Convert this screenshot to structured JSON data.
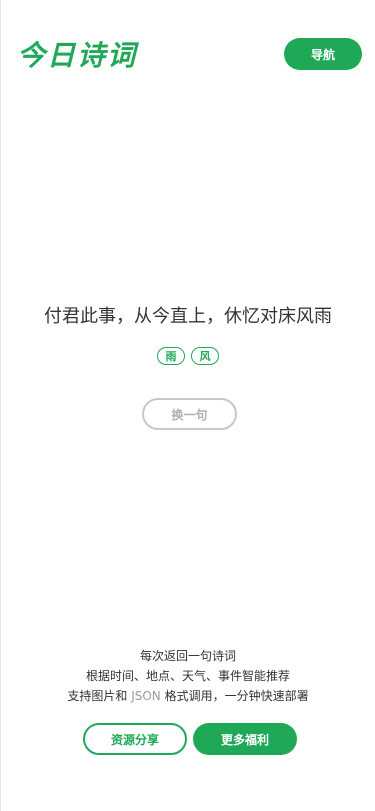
{
  "header": {
    "logo_text": "今日诗词",
    "nav_label": "导航"
  },
  "poem": {
    "text": "付君此事，从今直上，休忆对床风雨",
    "tags": [
      "雨",
      "风"
    ],
    "refresh_label": "换一句"
  },
  "description": {
    "line1": "每次返回一句诗词",
    "line2": "根据时间、地点、天气、事件智能推荐",
    "line3_prefix": "支持图片和 ",
    "line3_json": "JSON",
    "line3_suffix": " 格式调用，一分钟快速部署"
  },
  "footer": {
    "resources_label": "资源分享",
    "more_label": "更多福利"
  },
  "colors": {
    "brand_green": "#1fa957",
    "disabled_gray": "#c8c8c8"
  }
}
